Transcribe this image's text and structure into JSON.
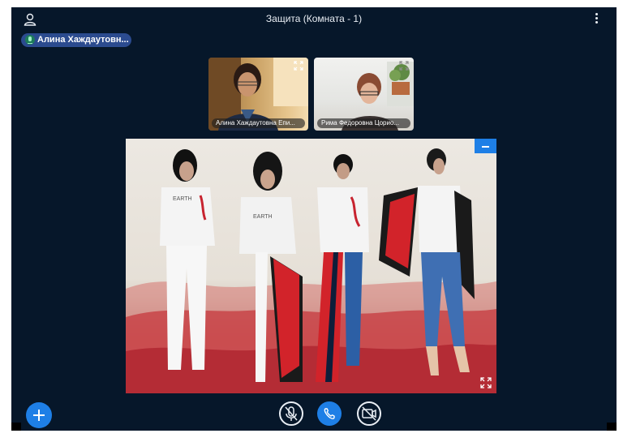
{
  "room": {
    "title": "Защита (Комната - 1)"
  },
  "active_speaker": {
    "name": "Алина Хаждаутовн..."
  },
  "participants": [
    {
      "name": "Алина Хаждаутовна Епи..."
    },
    {
      "name": "Рима Федоровна Цорио..."
    }
  ],
  "icons": {
    "user": "user-icon",
    "menu": "more-vertical-icon",
    "mic": "microphone-icon",
    "expand": "expand-icon",
    "minimize": "minus-icon",
    "add": "plus-icon",
    "mic_off": "microphone-off-icon",
    "hangup": "phone-icon",
    "camera_off": "video-off-icon"
  },
  "colors": {
    "background": "#06172a",
    "accent": "#1e7fe6",
    "speaker_badge": "#2b4b8f"
  }
}
